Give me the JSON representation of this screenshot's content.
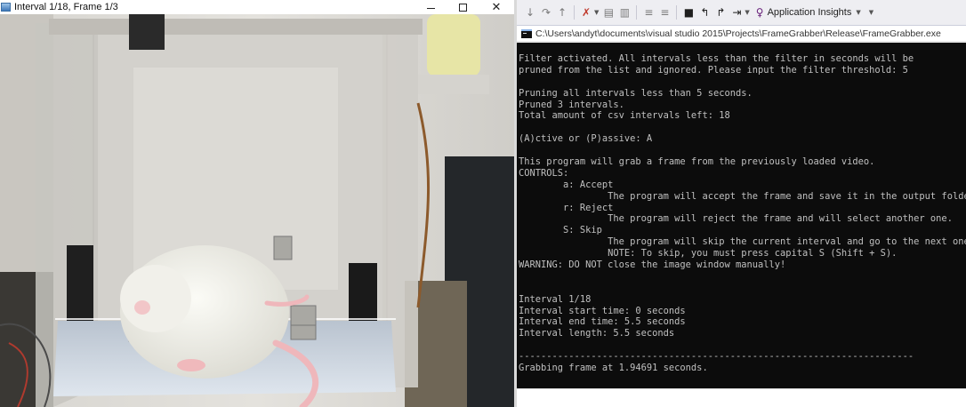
{
  "image_window": {
    "title": "Interval 1/18, Frame 1/3"
  },
  "toolbar": {
    "application_insights_label": "Application Insights",
    "icons": [
      "comment-icon",
      "uncomment-icon",
      "indent-icon",
      "outdent-icon",
      "bookmark-icon",
      "prev-bookmark-icon",
      "next-bookmark-icon",
      "clear-bookmarks-icon",
      "lightbulb-icon"
    ]
  },
  "console": {
    "title": "C:\\Users\\andyt\\documents\\visual studio 2015\\Projects\\FrameGrabber\\Release\\FrameGrabber.exe",
    "lines": [
      "Filter activated. All intervals less than the filter in seconds will be",
      "pruned from the list and ignored. Please input the filter threshold: 5",
      "",
      "Pruning all intervals less than 5 seconds.",
      "Pruned 3 intervals.",
      "Total amount of csv intervals left: 18",
      "",
      "(A)ctive or (P)assive: A",
      "",
      "This program will grab a frame from the previously loaded video.",
      "CONTROLS:",
      "        a: Accept",
      "                The program will accept the frame and save it in the output folder.",
      "        r: Reject",
      "                The program will reject the frame and will select another one.",
      "        S: Skip",
      "                The program will skip the current interval and go to the next one.",
      "                NOTE: To skip, you must press capital S (Shift + S).",
      "WARNING: DO NOT close the image window manually!",
      "",
      "",
      "Interval 1/18",
      "Interval start time: 0 seconds",
      "Interval end time: 5.5 seconds",
      "Interval length: 5.5 seconds",
      "",
      "-----------------------------------------------------------------------",
      "Grabbing frame at 1.94691 seconds."
    ]
  },
  "colors": {
    "console_bg": "#0c0c0c",
    "console_fg": "#c0c0c0",
    "vs_toolbar_bg": "#eeeef2"
  }
}
